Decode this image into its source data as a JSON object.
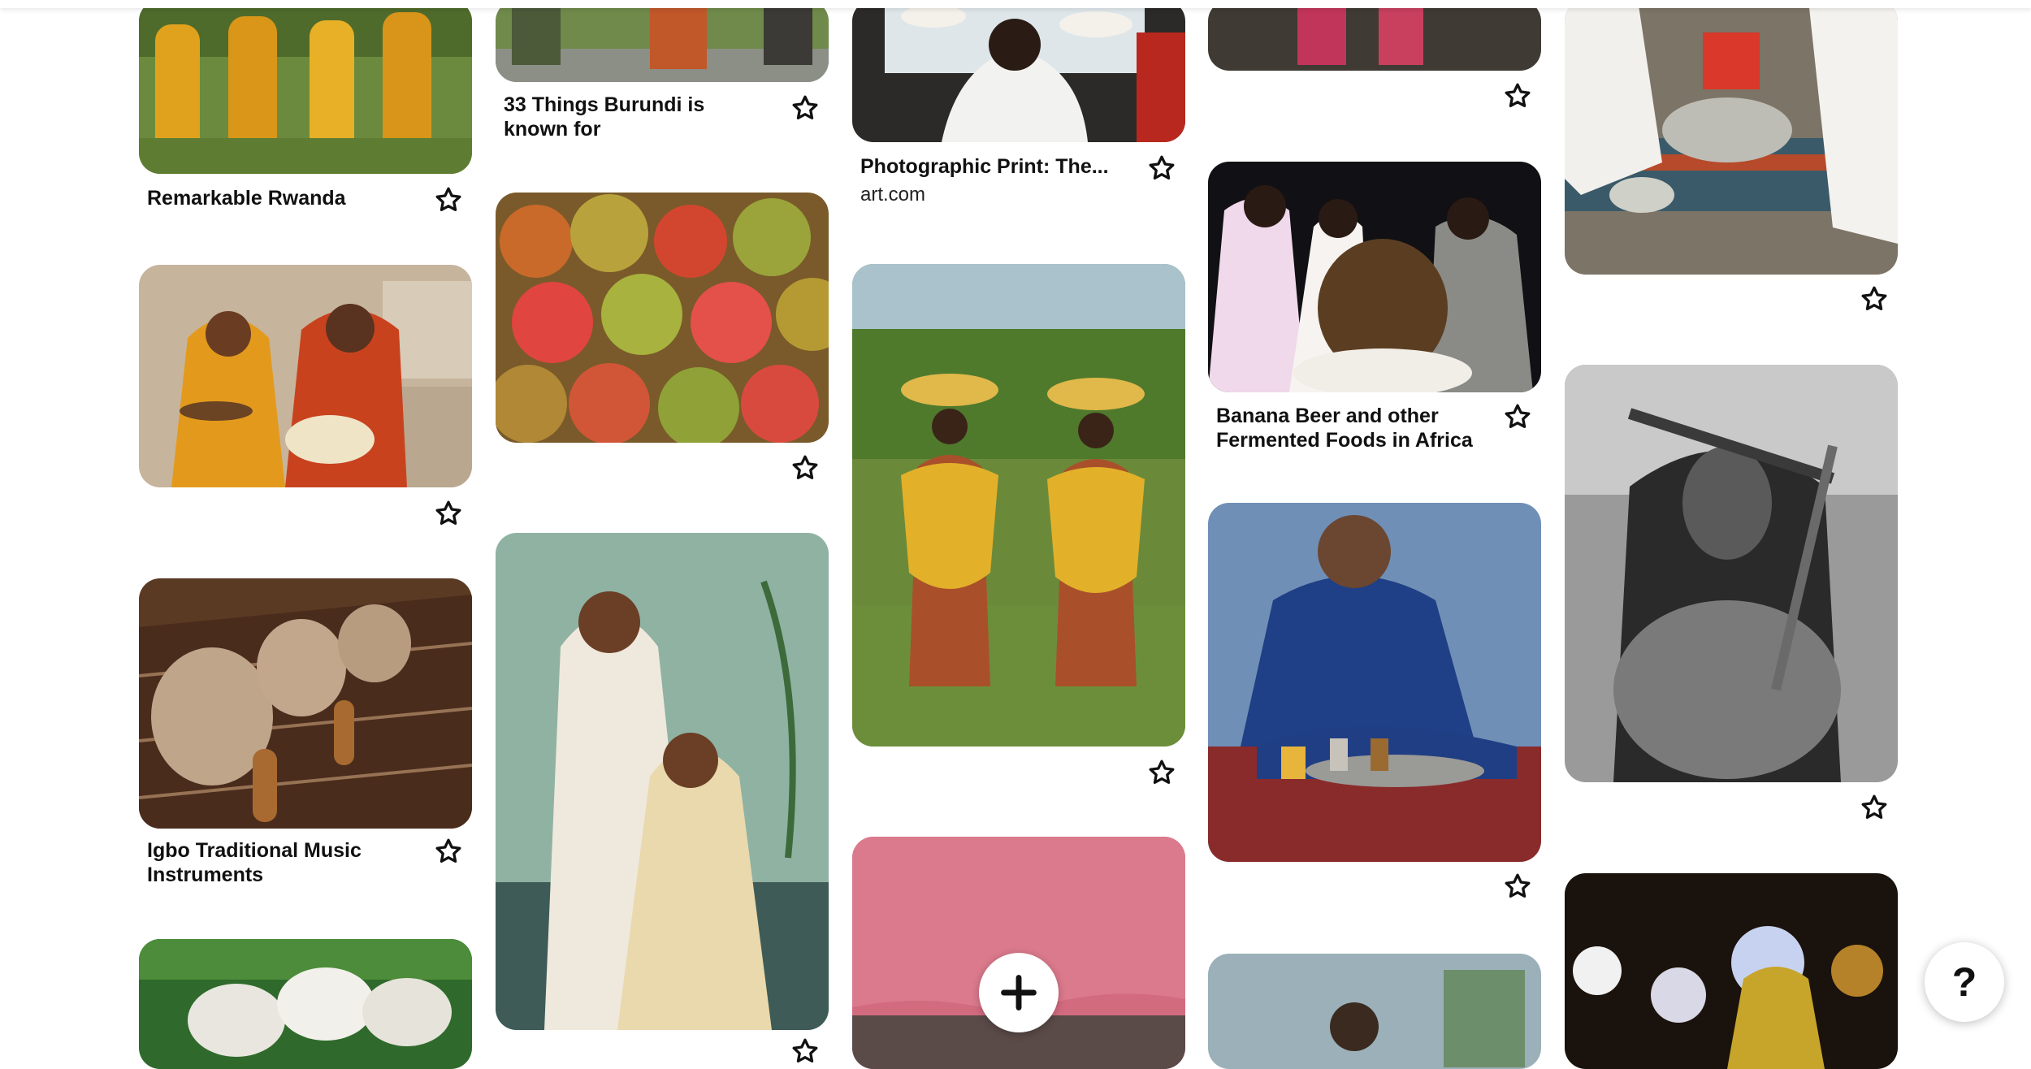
{
  "pins": {
    "remarkable_rwanda": {
      "title": "Remarkable Rwanda"
    },
    "burundi": {
      "title": "33 Things Burundi is known for"
    },
    "photographic_print": {
      "title": "Photographic Print: The...",
      "source": "art.com"
    },
    "banana_beer": {
      "title": "Banana Beer and other Fermented Foods in Africa"
    },
    "igbo": {
      "title": "Igbo Traditional Music Instruments"
    }
  },
  "icons": {
    "save": "star-outline-icon",
    "add": "plus-icon",
    "help": "question-mark-icon"
  },
  "help_label": "?",
  "colors": {
    "background": "#ffffff",
    "text": "#111111",
    "accent": "#111111"
  }
}
